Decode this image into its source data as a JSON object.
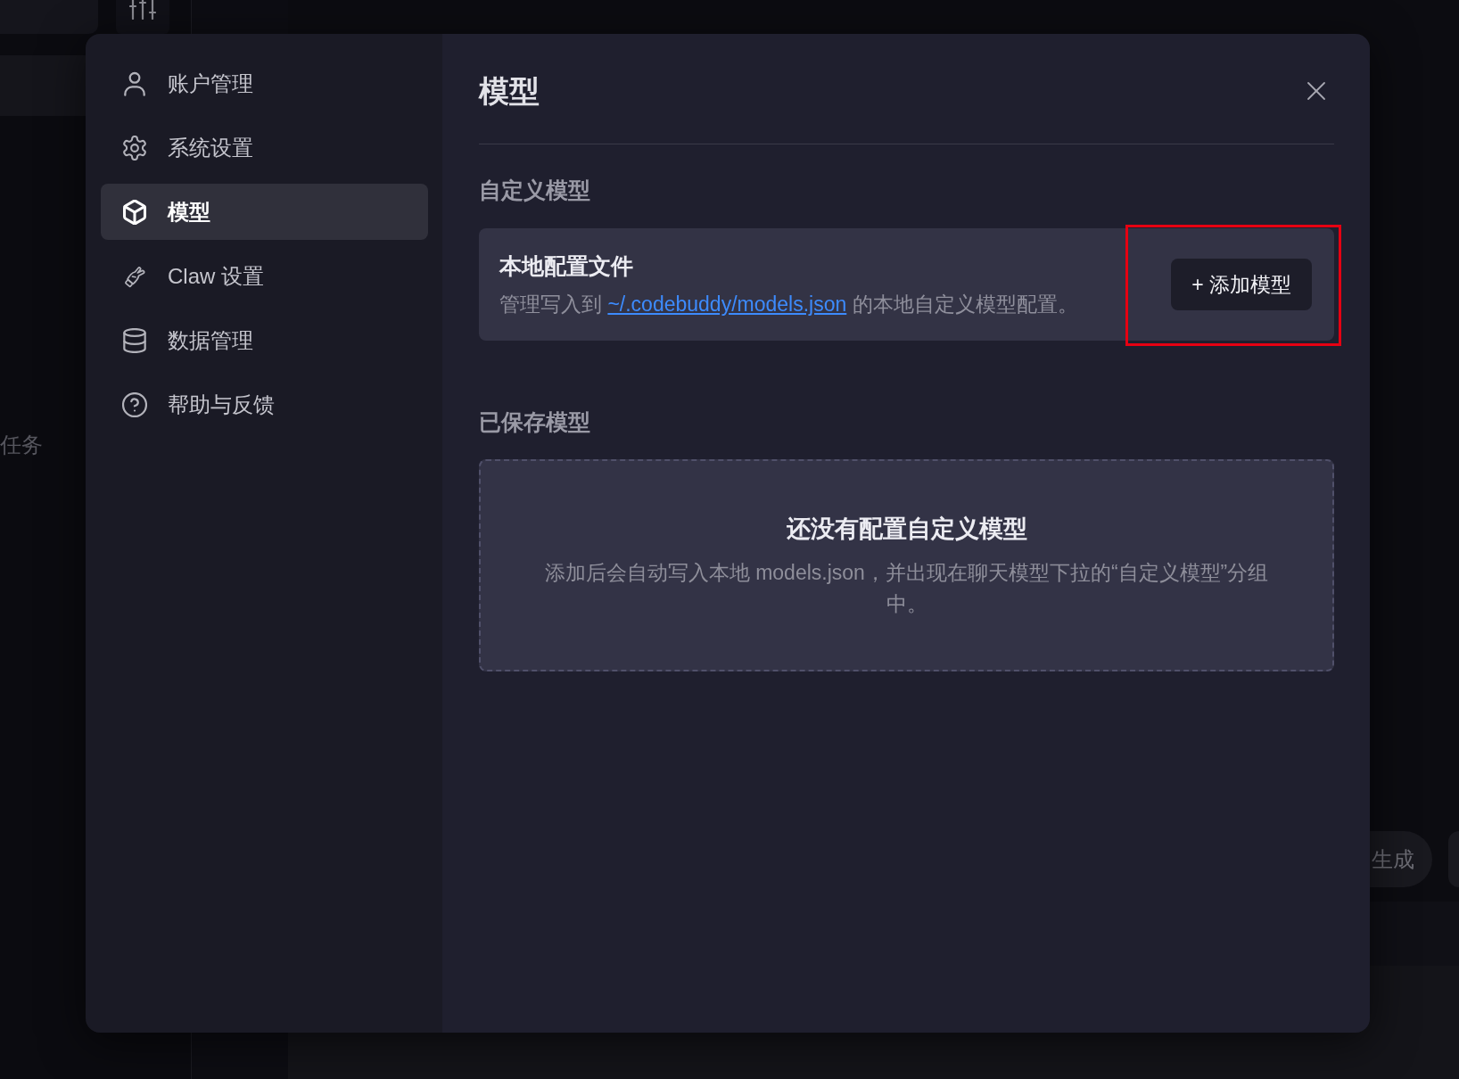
{
  "background": {
    "side_text": "任务",
    "chip_label": "生成"
  },
  "dialog": {
    "nav": [
      {
        "label": "账户管理",
        "selected": false
      },
      {
        "label": "系统设置",
        "selected": false
      },
      {
        "label": "模型",
        "selected": true
      },
      {
        "label": "Claw 设置",
        "selected": false
      },
      {
        "label": "数据管理",
        "selected": false
      },
      {
        "label": "帮助与反馈",
        "selected": false
      }
    ],
    "title": "模型",
    "custom_section": {
      "heading": "自定义模型",
      "card": {
        "title": "本地配置文件",
        "description": {
          "before": "管理写入到",
          "link": "~/.codebuddy/models.json",
          "after": "的本地自定义模型配置。"
        },
        "button": {
          "label": "+ 添加模型",
          "highlighted": true
        }
      }
    },
    "saved_section": {
      "heading": "已保存模型",
      "empty_state": {
        "title": "还没有配置自定义模型",
        "description": "添加后会自动写入本地 models.json，并出现在聊天模型下拉的“自定义模型”分组中。"
      }
    }
  }
}
